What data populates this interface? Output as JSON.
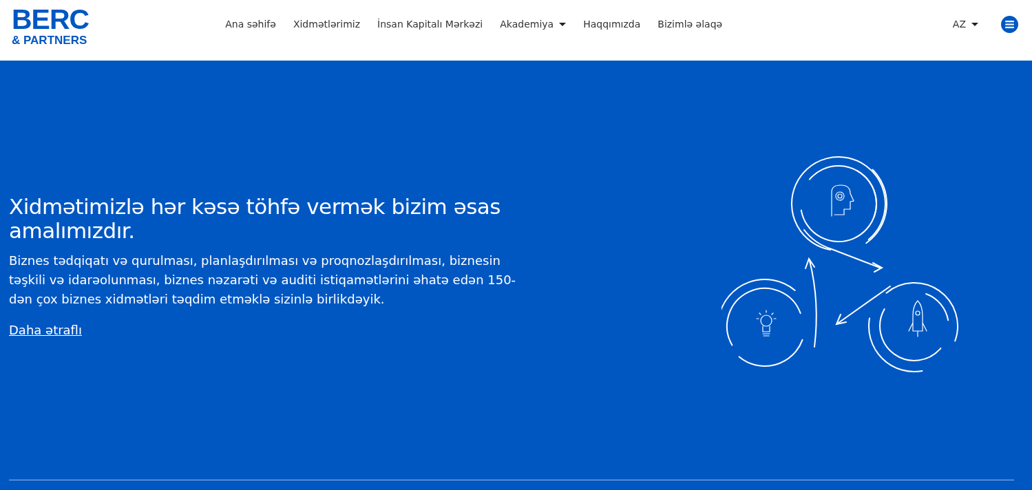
{
  "logo": {
    "line_1": "BERC",
    "line_2": "& PARTNERS"
  },
  "nav": [
    {
      "label": "Ana səhifə",
      "has_dropdown": false
    },
    {
      "label": "Xidmətlərimiz",
      "has_dropdown": false
    },
    {
      "label": "İnsan Kapitalı Mərkəzi",
      "has_dropdown": false
    },
    {
      "label": "Akademiya",
      "has_dropdown": true
    },
    {
      "label": "Haqqımızda",
      "has_dropdown": false
    },
    {
      "label": "Bizimlə əlaqə",
      "has_dropdown": false
    }
  ],
  "language": "AZ",
  "hero": {
    "title": "Xidmətimizlə hər kəsə töhfə vermək bizim əsas amalımızdır.",
    "text": "Biznes tədqiqatı və qurulması, planlaşdırılması və proqnozlaşdırılması, biznesin təşkili və idarəolunması, biznes nəzarəti və auditi istiqamətlərini əhatə edən 150-dən çox biznes xidmətləri təqdim etməklə sizinlə birlikdəyik.",
    "link": "Daha ətraflı"
  }
}
